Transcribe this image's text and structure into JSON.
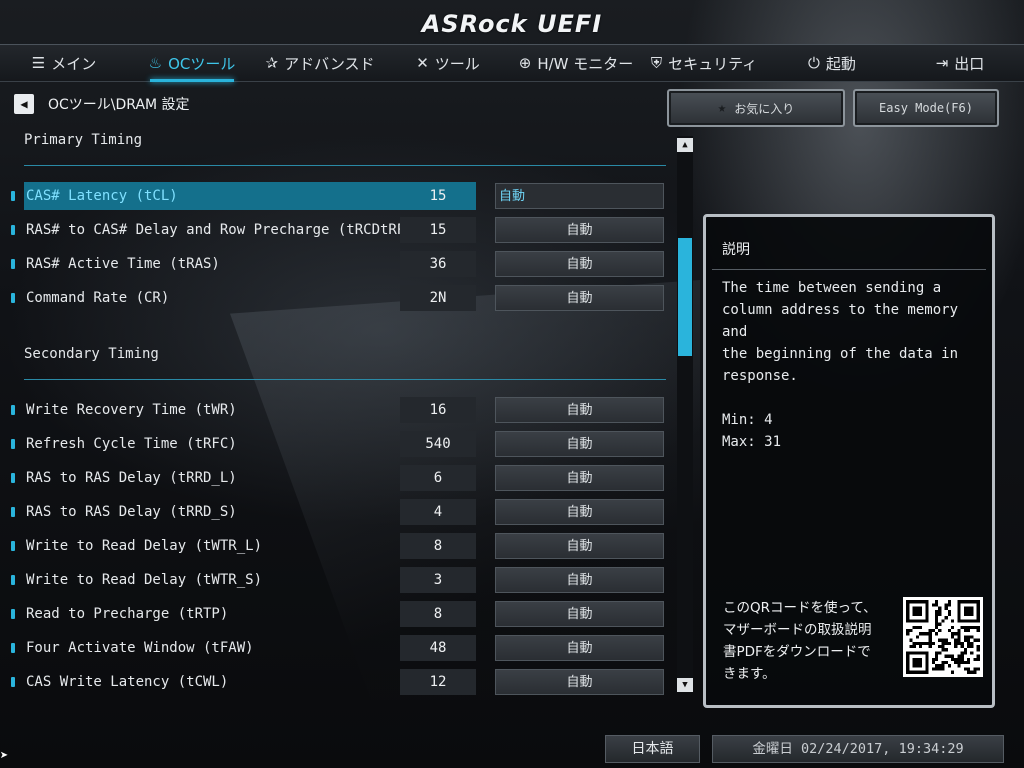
{
  "brand": {
    "logo_text": "ASRock UEFI"
  },
  "nav": [
    {
      "label": "メイン",
      "icon": "list-icon",
      "glyph": "☰",
      "active": false
    },
    {
      "label": "OCツール",
      "icon": "flame-icon",
      "glyph": "♨",
      "active": true
    },
    {
      "label": "アドバンスド",
      "icon": "star-icon",
      "glyph": "✰",
      "active": false
    },
    {
      "label": "ツール",
      "icon": "tools-icon",
      "glyph": "✕",
      "active": false
    },
    {
      "label": "H/W モニター",
      "icon": "crosshair-icon",
      "glyph": "⊕",
      "active": false
    },
    {
      "label": "セキュリティ",
      "icon": "shield-icon",
      "glyph": "⛨",
      "active": false
    },
    {
      "label": "起動",
      "icon": "power-icon",
      "glyph": "⏻",
      "active": false
    },
    {
      "label": "出口",
      "icon": "exit-door-icon",
      "glyph": "⇥",
      "active": false
    }
  ],
  "breadcrumb": {
    "back_glyph": "◀",
    "text": "OCツール\\DRAM 設定"
  },
  "buttons": {
    "favorite_label": "お気に入り",
    "favorite_glyph": "★",
    "easy_mode_label": "Easy Mode(F6)"
  },
  "sections": {
    "primary": "Primary Timing",
    "secondary": "Secondary Timing"
  },
  "primary_rows": [
    {
      "label": "CAS# Latency (tCL)",
      "current": "15",
      "setting": "自動",
      "active": true
    },
    {
      "label": "RAS# to CAS# Delay and Row Precharge (tRCDtRP)",
      "current": "15",
      "setting": "自動"
    },
    {
      "label": "RAS# Active Time (tRAS)",
      "current": "36",
      "setting": "自動"
    },
    {
      "label": "Command Rate (CR)",
      "current": "2N",
      "setting": "自動"
    }
  ],
  "secondary_rows": [
    {
      "label": "Write Recovery Time (tWR)",
      "current": "16",
      "setting": "自動"
    },
    {
      "label": "Refresh Cycle Time (tRFC)",
      "current": "540",
      "setting": "自動"
    },
    {
      "label": "RAS to RAS Delay (tRRD_L)",
      "current": "6",
      "setting": "自動"
    },
    {
      "label": "RAS to RAS Delay (tRRD_S)",
      "current": "4",
      "setting": "自動"
    },
    {
      "label": "Write to Read Delay (tWTR_L)",
      "current": "8",
      "setting": "自動"
    },
    {
      "label": "Write to Read Delay (tWTR_S)",
      "current": "3",
      "setting": "自動"
    },
    {
      "label": "Read to Precharge (tRTP)",
      "current": "8",
      "setting": "自動"
    },
    {
      "label": "Four Activate Window (tFAW)",
      "current": "48",
      "setting": "自動"
    },
    {
      "label": "CAS Write Latency (tCWL)",
      "current": "12",
      "setting": "自動"
    }
  ],
  "scrollbar": {
    "up_glyph": "▲",
    "down_glyph": "▼"
  },
  "description": {
    "title": "説明",
    "text": "The time between sending a\ncolumn address to the memory and\nthe beginning of the data in\nresponse.\n\nMin: 4\nMax: 31",
    "qr_text": "このQRコードを使って、マザーボードの取扱説明書PDFをダウンロードできます。"
  },
  "status": {
    "language": "日本語",
    "datetime": "金曜日 02/24/2017, 19:34:29"
  },
  "colors": {
    "accent": "#2ab4dc",
    "active_row": "#14708c",
    "background": "#0b0d10"
  }
}
